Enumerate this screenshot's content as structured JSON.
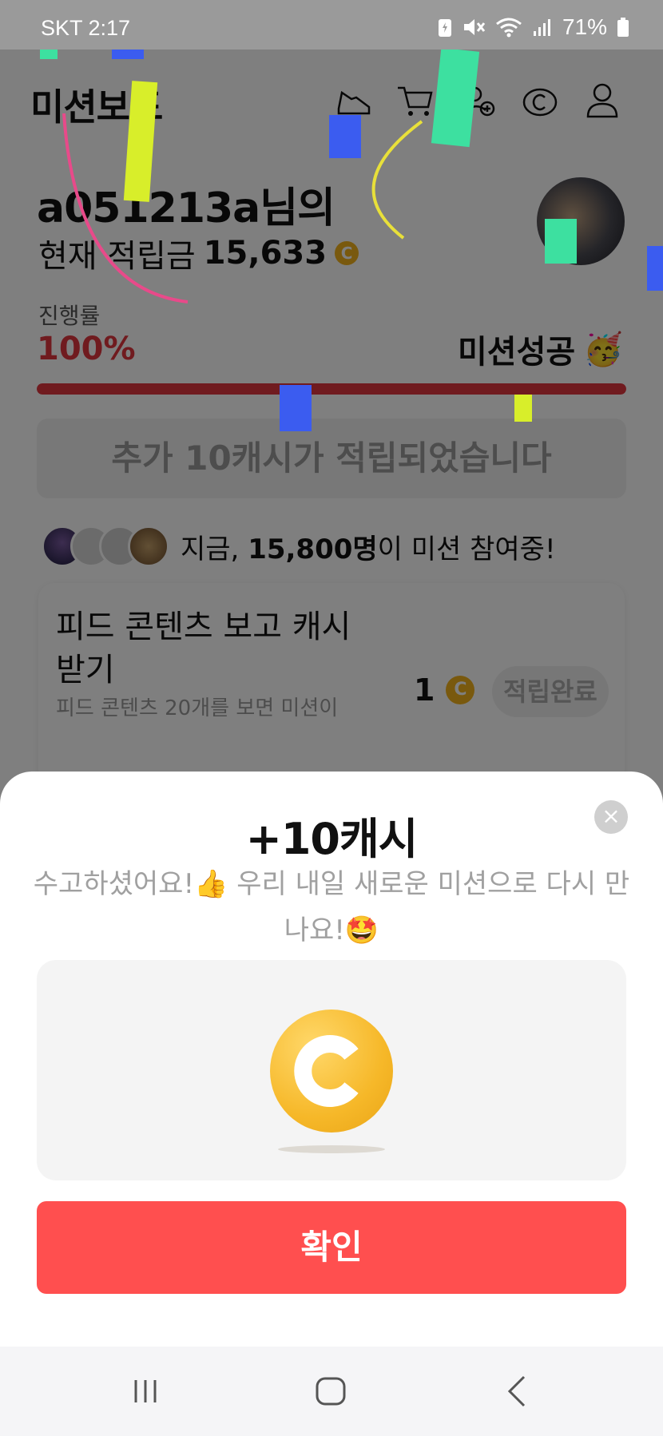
{
  "status_bar": {
    "carrier_time": "SKT 2:17",
    "battery": "71%",
    "icons": [
      "battery-saver-icon",
      "mute-icon",
      "wifi-icon",
      "signal-icon",
      "battery-icon"
    ]
  },
  "header": {
    "title": "미션보드",
    "icons": [
      "shoe-icon",
      "cart-icon",
      "add-friend-icon",
      "coin-icon",
      "profile-icon"
    ]
  },
  "user": {
    "greeting": "a051213a님의",
    "points_label": "현재 적립금",
    "points_value": "15,633",
    "coin_symbol": "C"
  },
  "progress": {
    "label": "진행률",
    "value": "100%",
    "fraction": 1.0,
    "status": "미션성공",
    "status_emoji": "🥳"
  },
  "extra_cash_text": "추가 10캐시가 적립되었습니다",
  "participants": {
    "prefix": "지금, ",
    "count": "15,800명",
    "suffix": "이 미션 참여중!"
  },
  "mission_card": {
    "title": "피드 콘텐츠 보고 캐시 받기",
    "description": "피드 콘텐츠 20개를 보면 미션이",
    "reward": "1",
    "status": "적립완료"
  },
  "sheet": {
    "title": "+10캐시",
    "message": "수고하셨어요!👍 우리 내일 새로운 미션으로 다시 만나요!🤩",
    "close_label": "×",
    "confirm_label": "확인",
    "coin_symbol": "C"
  },
  "colors": {
    "accent": "#ff4f4f",
    "progress": "#e0363f",
    "coin": "#f6b829"
  },
  "nav": {
    "icons": [
      "recent-apps-icon",
      "home-icon",
      "back-icon"
    ]
  }
}
